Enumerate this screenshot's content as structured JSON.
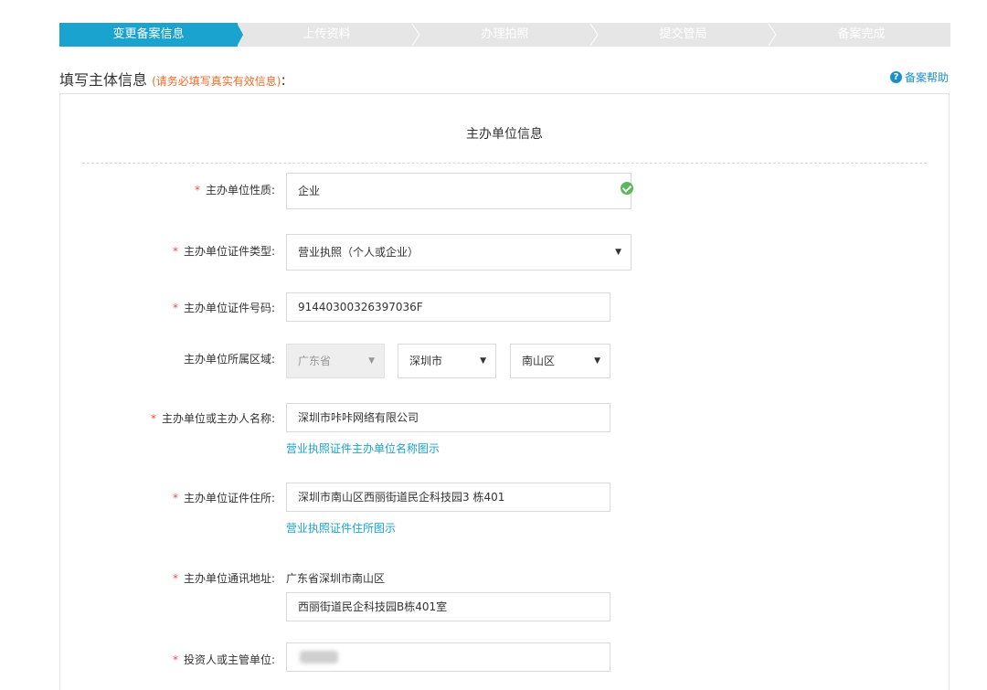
{
  "steps": [
    "变更备案信息",
    "上传资料",
    "办理拍照",
    "提交管局",
    "备案完成"
  ],
  "heading": {
    "title": "填写主体信息",
    "note": "(请务必填写真实有效信息)",
    "colon": ":"
  },
  "help": {
    "label": "备案帮助",
    "icon": "question-circle-icon"
  },
  "panel_title": "主办单位信息",
  "required_mark": "*",
  "form": {
    "nature": {
      "label": "主办单位性质:",
      "value": "企业"
    },
    "cert_type": {
      "label": "主办单位证件类型:",
      "value": "营业执照（个人或企业）"
    },
    "cert_no": {
      "label": "主办单位证件号码:",
      "value": "91440300326397036F"
    },
    "region": {
      "label": "主办单位所属区域:",
      "province": "广东省",
      "city": "深圳市",
      "district": "南山区"
    },
    "name": {
      "label": "主办单位或主办人名称:",
      "value": "深圳市咔咔网络有限公司",
      "hint": "营业执照证件主办单位名称图示"
    },
    "cert_address": {
      "label": "主办单位证件住所:",
      "value": "深圳市南山区西丽街道民企科技园3 栋401",
      "hint": "营业执照证件住所图示"
    },
    "mail_address": {
      "label": "主办单位通讯地址:",
      "prefix": "广东省深圳市南山区",
      "value": "西丽街道民企科技园B栋401室"
    },
    "investor": {
      "label": "投资人或主管单位:",
      "value": ""
    }
  },
  "colors": {
    "active_step": "#1aa3cf",
    "inactive_step": "#e6e6e6",
    "required": "#f04b4b",
    "note": "#f06a27",
    "link": "#1aa3cf",
    "valid": "#5bb75b"
  }
}
